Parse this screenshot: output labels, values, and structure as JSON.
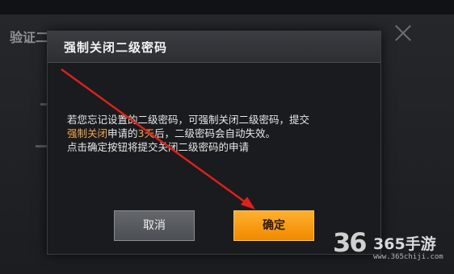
{
  "background": {
    "title": "验证二级密码"
  },
  "modal": {
    "title": "强制关闭二级密码",
    "body": {
      "line1": "若您忘记设置的二级密码，可强制关闭二级密码，提交",
      "line2_highlight1": "强制关闭",
      "line2_mid": "申请的",
      "line2_highlight2": "3天",
      "line2_end": "后，二级密码会自动失效。",
      "line3": "点击确定按钮将提交关闭二级密码的申请"
    },
    "cancel_label": "取消",
    "confirm_label": "确定"
  },
  "watermark": {
    "logo": "36",
    "brand": "365手游",
    "url": "www.365chiji.com"
  },
  "colors": {
    "highlight": "#f2a84c",
    "confirm_button": "#f59a10",
    "annotation_arrow": "#e0201a"
  }
}
